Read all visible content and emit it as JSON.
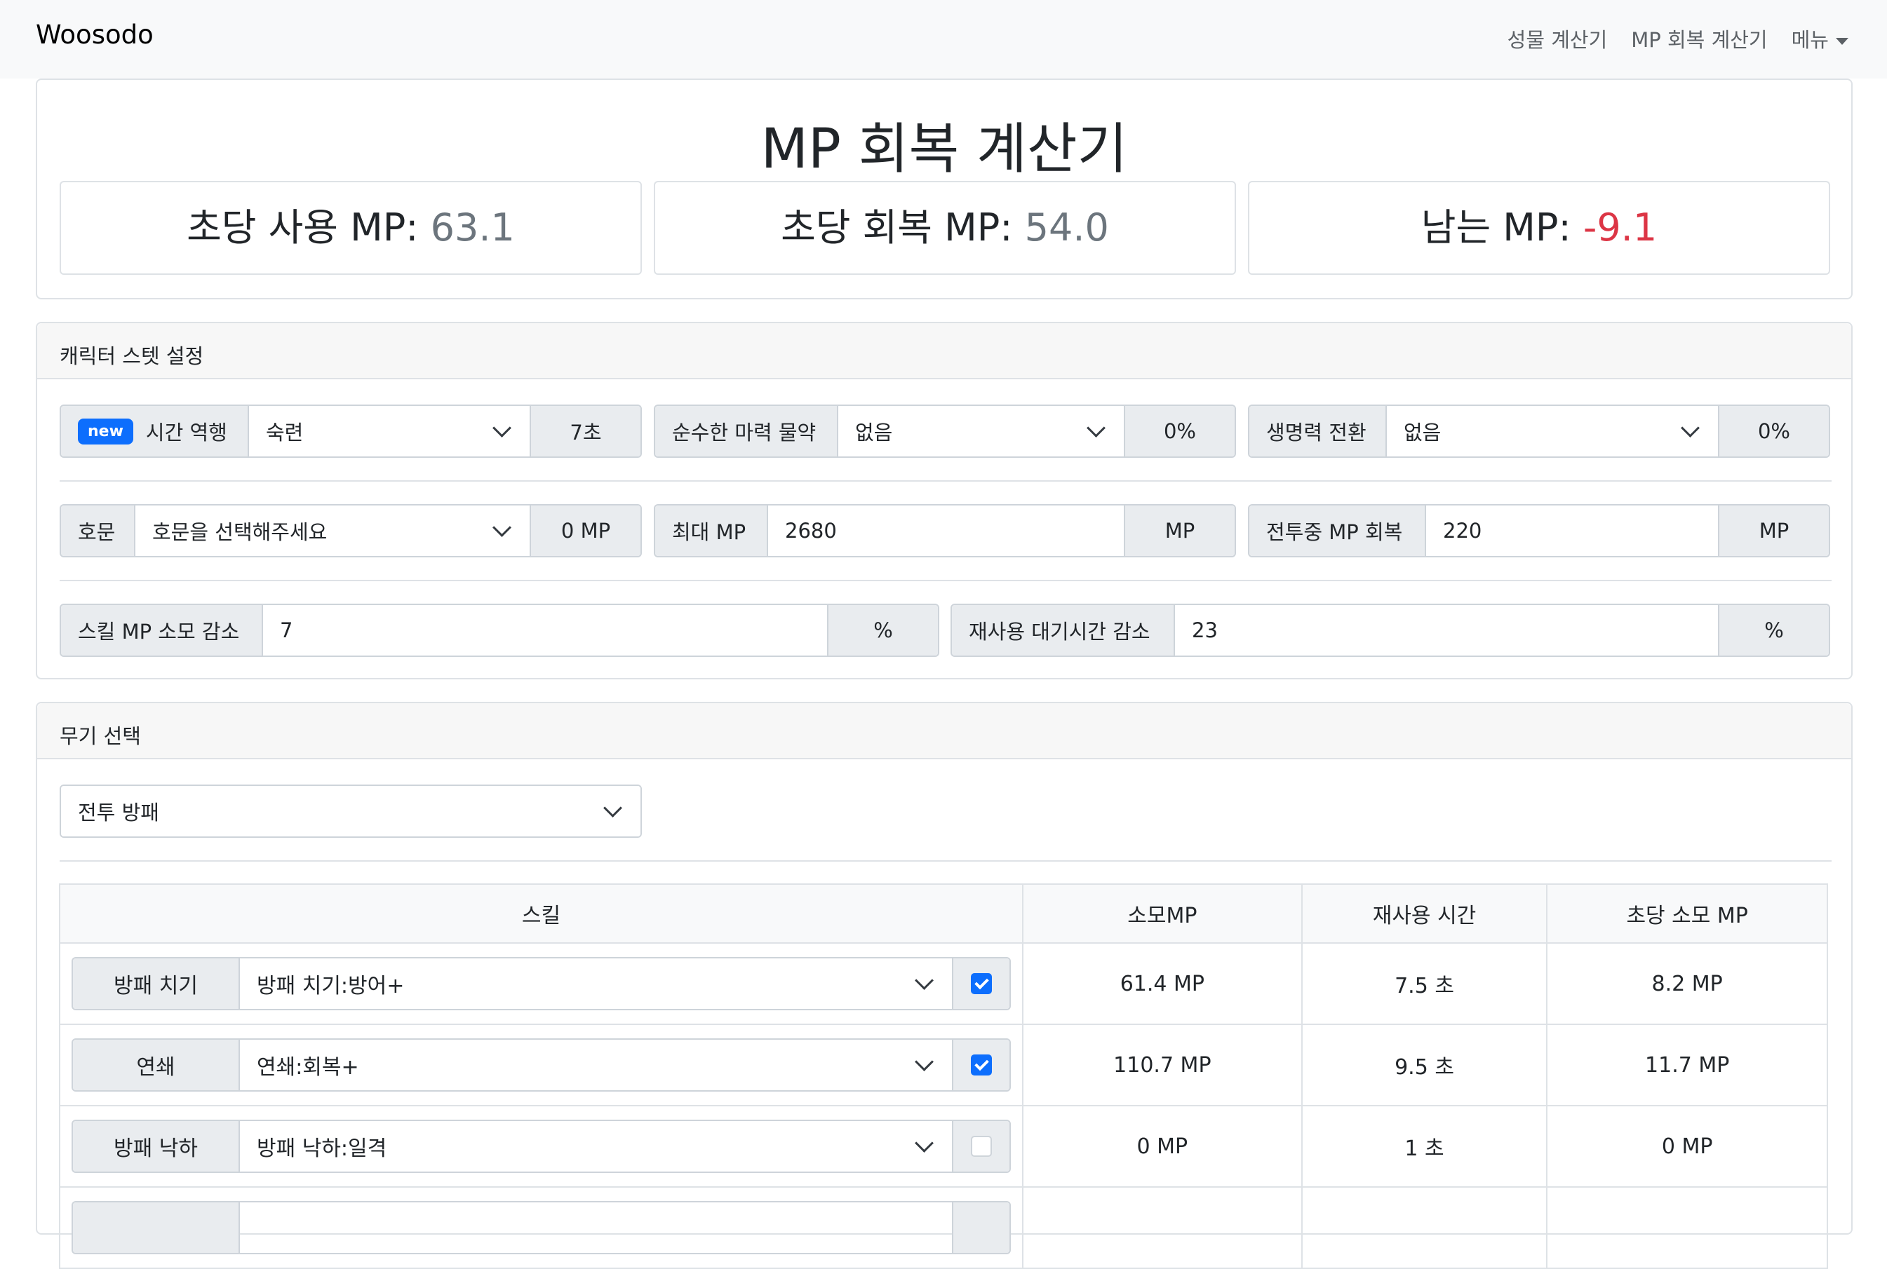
{
  "navbar": {
    "brand": "Woosodo",
    "links": [
      "성물 계산기",
      "MP 회복 계산기",
      "메뉴"
    ]
  },
  "summary": {
    "title": "MP 회복 계산기",
    "stats": [
      {
        "label": "초당 사용 MP:",
        "value": "63.1"
      },
      {
        "label": "초당 회복 MP:",
        "value": "54.0"
      },
      {
        "label": "남는 MP:",
        "value": "-9.1"
      }
    ]
  },
  "stats_card": {
    "header": "캐릭터 스텟 설정",
    "time_reversal": {
      "badge": "new",
      "label": "시간 역행",
      "selected": "숙련",
      "suffix": "7초"
    },
    "pure_mana_potion": {
      "label": "순수한 마력 물약",
      "selected": "없음",
      "suffix": "0%"
    },
    "life_conversion": {
      "label": "생명력 전환",
      "selected": "없음",
      "suffix": "0%"
    },
    "title_select": {
      "label": "호문",
      "selected": "호문을 선택해주세요",
      "suffix": "0 MP"
    },
    "max_mp": {
      "label": "최대 MP",
      "value": "2680",
      "suffix": "MP"
    },
    "combat_mp_regen": {
      "label": "전투중 MP 회복",
      "value": "220",
      "suffix": "MP"
    },
    "skill_mp_reduction": {
      "label": "스킬 MP 소모 감소",
      "value": "7",
      "suffix": "%"
    },
    "cooldown_reduction": {
      "label": "재사용 대기시간 감소",
      "value": "23",
      "suffix": "%"
    }
  },
  "weapon_card": {
    "header": "무기 선택",
    "weapon_selected": "전투 방패",
    "table_headers": [
      "스킬",
      "소모MP",
      "재사용 시간",
      "초당 소모 MP"
    ],
    "rows": [
      {
        "skill": "방패 치기",
        "option": "방패 치기:방어+",
        "checked": true,
        "mp": "61.4 MP",
        "cooldown": "7.5 초",
        "mp_per_sec": "8.2 MP"
      },
      {
        "skill": "연쇄",
        "option": "연쇄:회복+",
        "checked": true,
        "mp": "110.7 MP",
        "cooldown": "9.5 초",
        "mp_per_sec": "11.7 MP"
      },
      {
        "skill": "방패 낙하",
        "option": "방패 낙하:일격",
        "checked": false,
        "mp": "0 MP",
        "cooldown": "1 초",
        "mp_per_sec": "0 MP"
      }
    ]
  }
}
